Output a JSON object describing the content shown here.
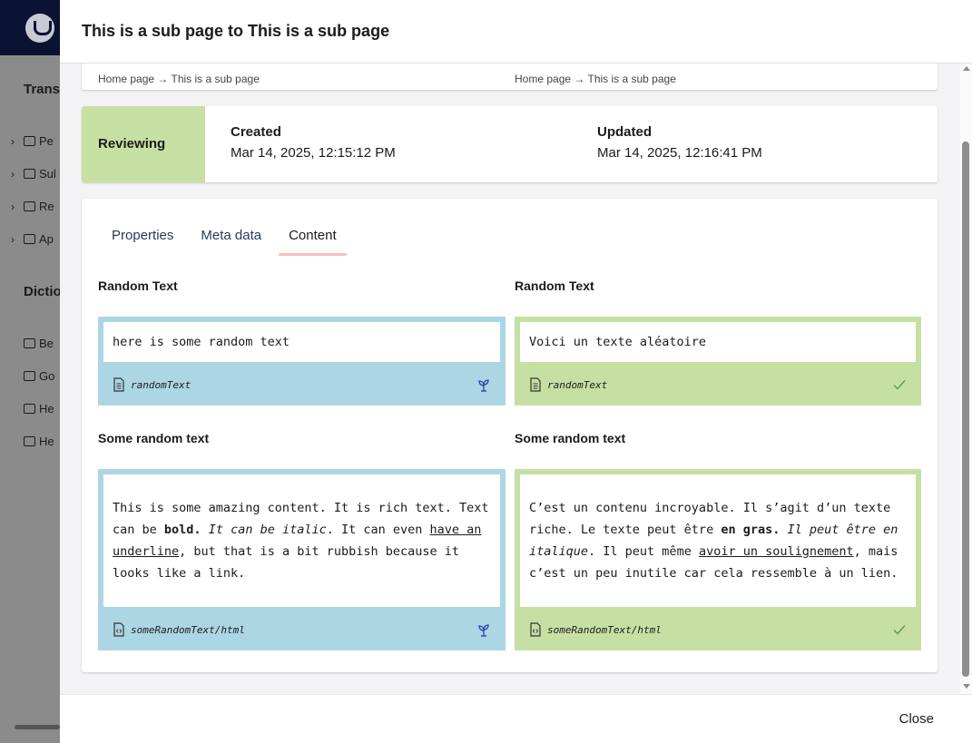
{
  "background": {
    "section_translation": "Transl",
    "nav_items": [
      "Pe",
      "Sul",
      "Re",
      "Ap"
    ],
    "section_dictionary": "Dictio",
    "dict_items": [
      "Be",
      "Go",
      "He",
      "He"
    ]
  },
  "modal": {
    "title": "This is a sub page to This is a sub page",
    "breadcrumb_left": "Home page → This is a sub page",
    "breadcrumb_right": "Home page → This is a sub page",
    "status": "Reviewing",
    "created_label": "Created",
    "created_value": "Mar 14, 2025, 12:15:12 PM",
    "updated_label": "Updated",
    "updated_value": "Mar 14, 2025, 12:16:41 PM",
    "tabs": [
      "Properties",
      "Meta data",
      "Content"
    ],
    "active_tab": "Content",
    "close_label": "Close"
  },
  "properties": {
    "random_text": {
      "label_source": "Random Text",
      "label_target": "Random Text",
      "source_value": "here is some random text",
      "target_value": "Voici un texte aléatoire",
      "alias": "randomText"
    },
    "rich_text": {
      "label_source": "Some random text",
      "label_target": "Some random text",
      "alias": "someRandomText/html",
      "source": {
        "p1": "This is some amazing content. It is rich text. Text can be ",
        "bold": "bold.",
        "sp1": " ",
        "italic": "It can be italic",
        "p2": ". It can even ",
        "underline": "have an underline",
        "p3": ", but that is a bit rubbish because it looks like a link."
      },
      "target": {
        "p1": "C’est un contenu incroyable. Il s’agit d’un texte riche. Le texte peut être ",
        "bold": "en gras.",
        "sp1": " ",
        "italic": "Il peut être en italique",
        "p2": ". Il peut même ",
        "underline": "avoir un soulignement",
        "p3": ", mais c’est un peu inutile car cela ressemble à un lien."
      }
    }
  },
  "colors": {
    "source_bg": "#acd6e4",
    "target_bg": "#c6e0a4",
    "status_bg": "#c6e0a4",
    "tab_underline": "#f5c1bc",
    "topbar": "#0a1331"
  }
}
